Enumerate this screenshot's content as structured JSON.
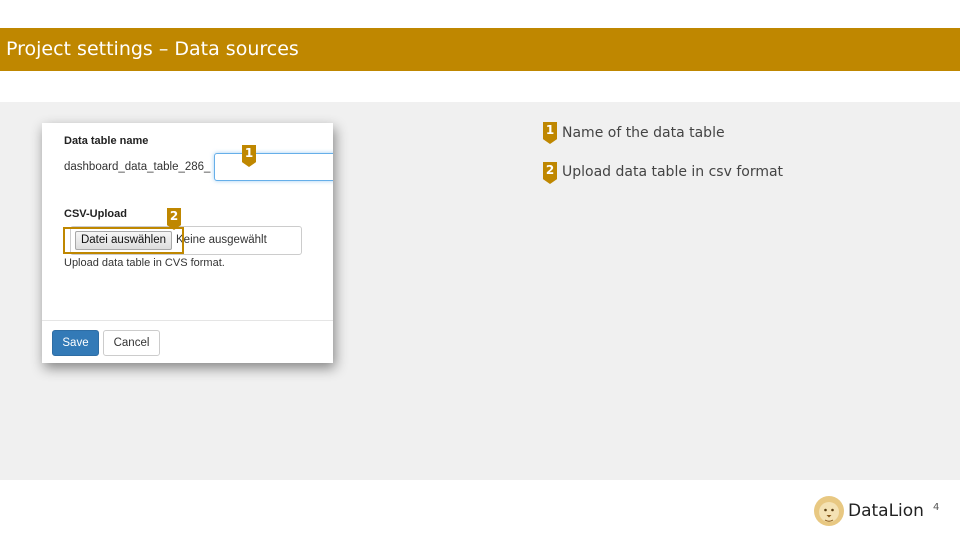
{
  "header": {
    "title": "Project settings – Data sources"
  },
  "dialog": {
    "table_name_label": "Data table name",
    "table_name_value": "dashboard_data_table_286_",
    "table_name_input_value": "",
    "csv_label": "CSV-Upload",
    "file_button_label": "Datei auswählen",
    "file_status": "Keine ausgewählt",
    "help_text": "Upload data table in CVS format.",
    "save_label": "Save",
    "cancel_label": "Cancel"
  },
  "markers": [
    "1",
    "2"
  ],
  "legend": [
    {
      "number": "1",
      "text": "Name of the data table"
    },
    {
      "number": "2",
      "text": "Upload data table in csv format"
    }
  ],
  "brand": {
    "name": "DataLion",
    "accent": "#bf8700"
  },
  "page_number": "4"
}
